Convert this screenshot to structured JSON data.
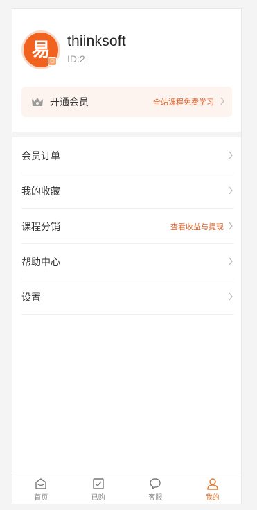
{
  "profile": {
    "avatar_glyph": "易",
    "username": "thiinksoft",
    "user_id": "ID:2"
  },
  "vip": {
    "icon": "crown-icon",
    "label": "开通会员",
    "promo": "全站课程免费学习"
  },
  "menu": [
    {
      "label": "会员订单",
      "aside": ""
    },
    {
      "label": "我的收藏",
      "aside": ""
    },
    {
      "label": "课程分销",
      "aside": "查看收益与提现"
    },
    {
      "label": "帮助中心",
      "aside": ""
    },
    {
      "label": "设置",
      "aside": ""
    }
  ],
  "tabbar": [
    {
      "label": "首页",
      "icon": "home-icon",
      "active": false
    },
    {
      "label": "已购",
      "icon": "checkbox-icon",
      "active": false
    },
    {
      "label": "客服",
      "icon": "chat-icon",
      "active": false
    },
    {
      "label": "我的",
      "icon": "user-icon",
      "active": true
    }
  ],
  "colors": {
    "accent": "#e07b34",
    "brand_orange": "#f0621e",
    "vip_bg": "#fdf3ef",
    "promo_text": "#d9622b"
  }
}
